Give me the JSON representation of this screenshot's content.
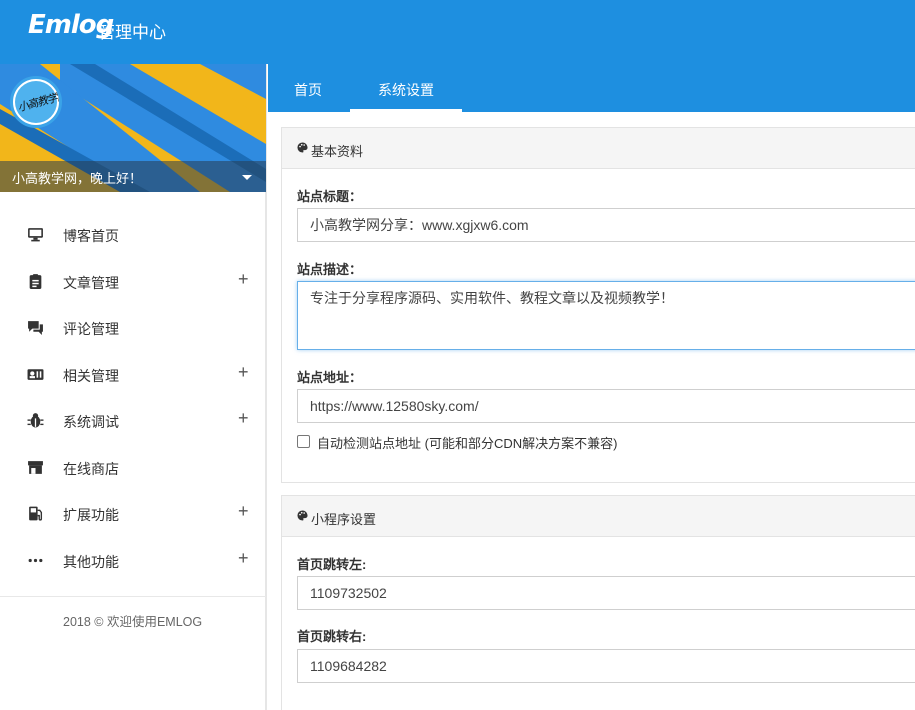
{
  "header": {
    "logo": "Emlog",
    "subtitle": "管理中心"
  },
  "sidebar": {
    "avatar_text": "小高教学网",
    "greeting": "小高教学网，晚上好！",
    "items": [
      {
        "label": "博客首页",
        "icon": "monitor-icon",
        "expandable": false
      },
      {
        "label": "文章管理",
        "icon": "clipboard-icon",
        "expandable": true
      },
      {
        "label": "评论管理",
        "icon": "comments-icon",
        "expandable": false
      },
      {
        "label": "相关管理",
        "icon": "id-card-icon",
        "expandable": true
      },
      {
        "label": "系统调试",
        "icon": "bug-icon",
        "expandable": true
      },
      {
        "label": "在线商店",
        "icon": "store-icon",
        "expandable": false
      },
      {
        "label": "扩展功能",
        "icon": "gas-pump-icon",
        "expandable": true
      },
      {
        "label": "其他功能",
        "icon": "ellipsis-icon",
        "expandable": true
      }
    ],
    "footer": "2018 © 欢迎使用EMLOG"
  },
  "tabs": [
    {
      "label": "首页",
      "active": false
    },
    {
      "label": "系统设置",
      "active": true
    }
  ],
  "basic_panel": {
    "title": "基本资料",
    "site_title_label": "站点标题：",
    "site_title_value": "小高教学网分享：www.xgjxw6.com",
    "site_desc_label": "站点描述：",
    "site_desc_value": "专注于分享程序源码、实用软件、教程文章以及视频教学！",
    "site_url_label": "站点地址：",
    "site_url_value": "https://www.12580sky.com/",
    "auto_detect_label": "自动检测站点地址 (可能和部分CDN解决方案不兼容)",
    "auto_detect_checked": false
  },
  "miniapp_panel": {
    "title": "小程序设置",
    "left_label": "首页跳转左:",
    "left_value": "1109732502",
    "right_label": "首页跳转右:",
    "right_value": "1109684282"
  },
  "colors": {
    "brand_blue": "#1e8fe0",
    "banner_yellow": "#f2b61a",
    "banner_blue": "#2f8be0"
  }
}
